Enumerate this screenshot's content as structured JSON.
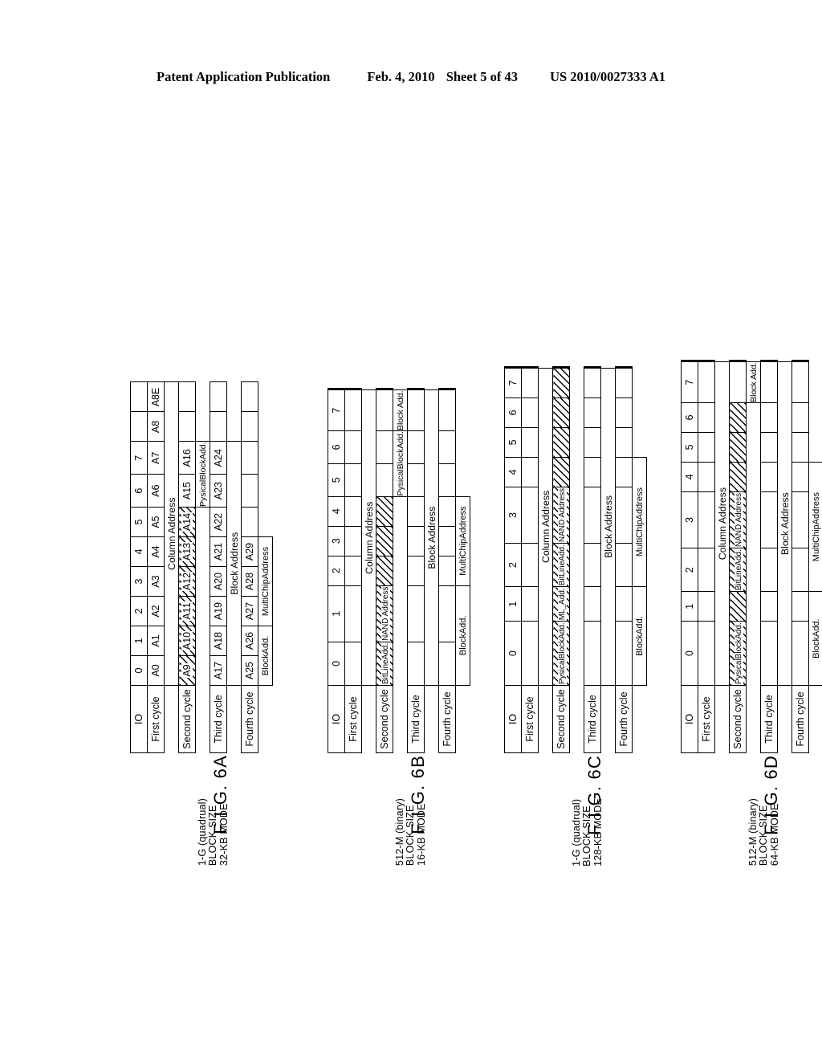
{
  "header": {
    "publication": "Patent Application Publication",
    "date": "Feb. 4, 2010",
    "sheet": "Sheet 5 of 43",
    "patent_number": "US 2010/0027333 A1"
  },
  "io_label": "IO",
  "io_columns": [
    "0",
    "1",
    "2",
    "3",
    "4",
    "5",
    "6",
    "7"
  ],
  "cycle_labels": {
    "first": "First cycle",
    "second": "Second cycle",
    "third": "Third cycle",
    "fourth": "Fourth cycle"
  },
  "annotations": {
    "column_address": "Column Address",
    "block_address": "Block Address",
    "block_add_short": "Block Add.",
    "blockadd": "BlockAdd.",
    "nand_address": "NAND Address",
    "bitline_add": "BitLineAdd.",
    "ml_add": "ML_Add.",
    "physical_block_add": "PysicalBlockAdd.",
    "multichip_address": "MultiChipAddress"
  },
  "figures": [
    {
      "id": "6A",
      "fignum": "F I G. 6A",
      "mode_lines": [
        "1-G (quadrual)",
        "BLOCK SIZE",
        "32-KB MODE"
      ],
      "first_cycle": [
        "A0",
        "A1",
        "A2",
        "A3",
        "A4",
        "A5",
        "A6",
        "A7",
        "A8",
        "A8E"
      ],
      "second_cycle": [
        "A9",
        "A10",
        "A11",
        "A12",
        "A13",
        "A14",
        "A15",
        "A16"
      ],
      "third_cycle": [
        "A17",
        "A18",
        "A19",
        "A20",
        "A21",
        "A22",
        "A23",
        "A24"
      ],
      "fourth_cycle": [
        "A25",
        "A26",
        "A27",
        "A28",
        "A29"
      ]
    },
    {
      "id": "6B",
      "fignum": "F I G. 6B",
      "mode_lines": [
        "512-M (binary)",
        "BLOCK SIZE",
        "16-KB MODE"
      ],
      "first_cycle": [
        "",
        "",
        "",
        "",
        "",
        "",
        "",
        ""
      ],
      "second_cycle": [
        "",
        "",
        "",
        "",
        "",
        "",
        "",
        ""
      ],
      "third_cycle": [
        "",
        "",
        "",
        "",
        "",
        "",
        "",
        ""
      ],
      "fourth_cycle": [
        "",
        "",
        "",
        "",
        ""
      ]
    },
    {
      "id": "6C",
      "fignum": "F I G. 6C",
      "mode_lines": [
        "1-G (quadrual)",
        "BLOCK SIZE",
        "128-KB MODE"
      ],
      "first_cycle": [
        "",
        "",
        "",
        "",
        "",
        "",
        "",
        ""
      ],
      "second_cycle": [
        "",
        "",
        "",
        "",
        "",
        "",
        "",
        ""
      ],
      "third_cycle": [
        "",
        "",
        "",
        "",
        "",
        "",
        "",
        ""
      ],
      "fourth_cycle": [
        "",
        "",
        "",
        "",
        ""
      ]
    },
    {
      "id": "6D",
      "fignum": "F I G. 6D",
      "mode_lines": [
        "512-M (binary)",
        "BLOCK SIZE",
        "64-KB MODE"
      ],
      "first_cycle": [
        "",
        "",
        "",
        "",
        "",
        "",
        "",
        ""
      ],
      "second_cycle": [
        "",
        "",
        "",
        "",
        "",
        "",
        "",
        ""
      ],
      "third_cycle": [
        "",
        "",
        "",
        "",
        "",
        "",
        "",
        ""
      ],
      "fourth_cycle": [
        "",
        "",
        "",
        "",
        ""
      ]
    }
  ]
}
